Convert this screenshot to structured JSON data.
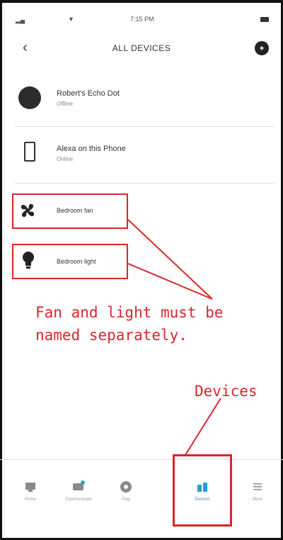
{
  "status_bar": {
    "time": "7:15 PM"
  },
  "header": {
    "title": "ALL DEVICES",
    "back_icon": "chevron-left-icon",
    "add_icon": "plus-circle-icon"
  },
  "devices": [
    {
      "name": "Robert's Echo Dot",
      "status": "Offline",
      "icon": "echo-dot-icon"
    },
    {
      "name": "Alexa on this Phone",
      "status": "Online",
      "icon": "phone-icon"
    },
    {
      "name": "Bedroom fan",
      "icon": "fan-icon"
    },
    {
      "name": "Bedroom light",
      "icon": "bulb-icon"
    }
  ],
  "annotations": {
    "note": "Fan and light must be\nnamed separately.",
    "devices_label": "Devices",
    "color": "#d9262c"
  },
  "bottom_nav": [
    {
      "label": "Home",
      "icon": "home-icon"
    },
    {
      "label": "Communicate",
      "icon": "chat-icon"
    },
    {
      "label": "Play",
      "icon": "play-icon"
    },
    {
      "label": "Devices",
      "icon": "devices-icon",
      "active": true
    },
    {
      "label": "More",
      "icon": "menu-icon"
    }
  ],
  "colors": {
    "accent": "#2a9bd6",
    "annotation": "#d9262c"
  }
}
